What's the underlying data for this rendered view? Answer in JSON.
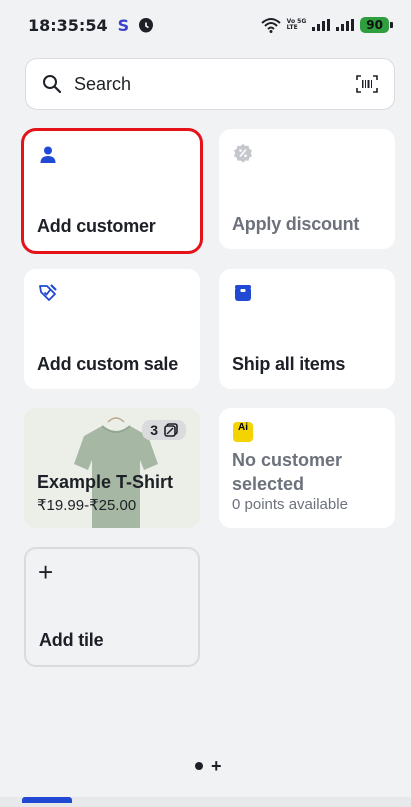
{
  "status": {
    "time": "18:35:54",
    "app_letter": "S",
    "volte_top": "Vo 5G",
    "volte_bottom": "LTE",
    "volte_top2": "Vo",
    "volte_bottom2": "LTE",
    "battery": "90"
  },
  "search": {
    "placeholder": "Search"
  },
  "tiles": {
    "add_customer": "Add customer",
    "apply_discount": "Apply discount",
    "add_custom_sale": "Add custom sale",
    "ship_all_items": "Ship all items",
    "product": {
      "name": "Example T-Shirt",
      "price": "₹19.99-₹25.00",
      "variant_count": "3"
    },
    "customer": {
      "ai_label": "Ai",
      "title": "No customer selected",
      "points": "0 points available"
    },
    "add_tile": "Add tile",
    "add_tile_plus": "+"
  },
  "pager": {
    "plus": "+"
  },
  "colors": {
    "accent": "#2149d4",
    "selection": "#e5121a",
    "battery": "#2e9e3f"
  }
}
